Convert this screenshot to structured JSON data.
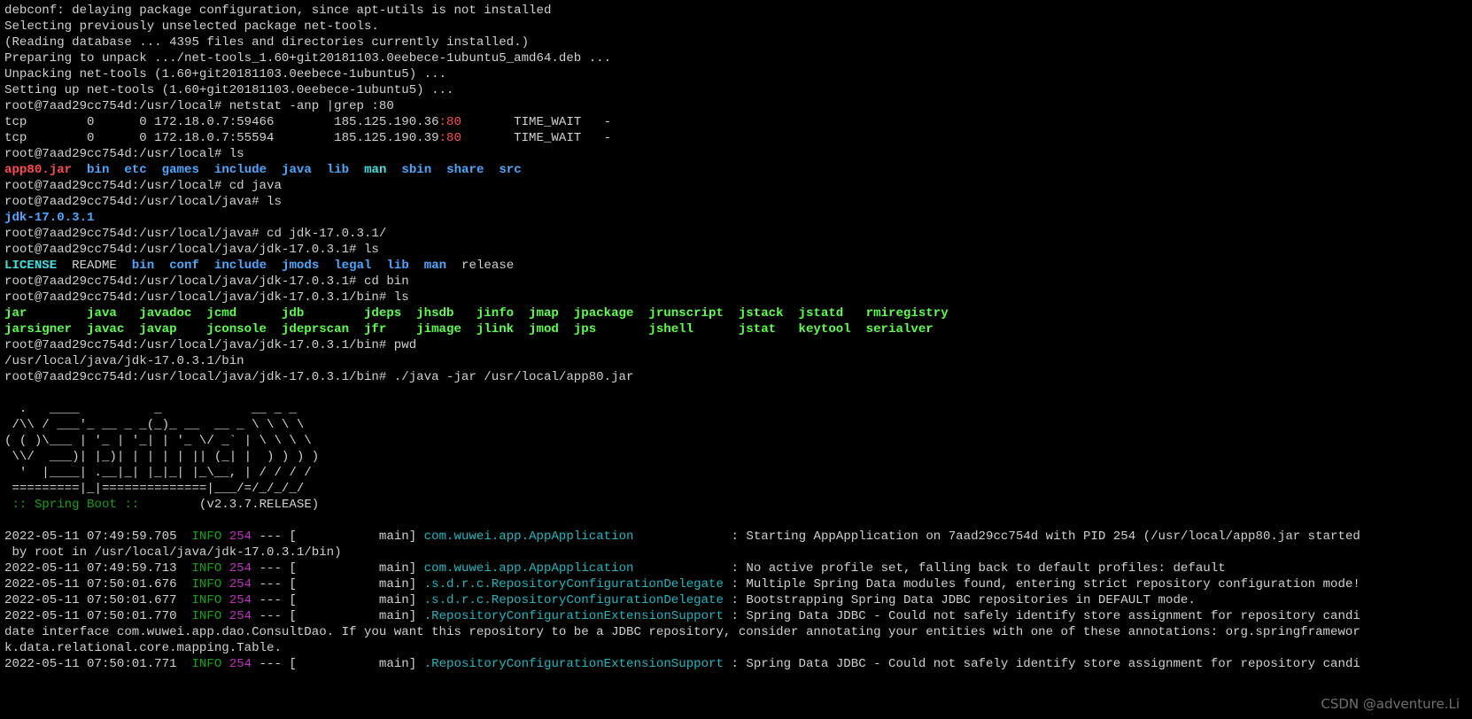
{
  "terminal": {
    "lines": [
      [
        [
          "debconf: delaying package configuration, since apt-utils is not installed",
          "n"
        ]
      ],
      [
        [
          "Selecting previously unselected package net-tools.",
          "n"
        ]
      ],
      [
        [
          "(Reading database ... 4395 files and directories currently installed.)",
          "n"
        ]
      ],
      [
        [
          "Preparing to unpack .../net-tools_1.60+git20181103.0eebece-1ubuntu5_amd64.deb ...",
          "n"
        ]
      ],
      [
        [
          "Unpacking net-tools (1.60+git20181103.0eebece-1ubuntu5) ...",
          "n"
        ]
      ],
      [
        [
          "Setting up net-tools (1.60+git20181103.0eebece-1ubuntu5) ...",
          "n"
        ]
      ],
      [
        [
          "root@7aad29cc754d:/usr/local# netstat -anp |grep :80",
          "n"
        ]
      ],
      [
        [
          "tcp        0      0 172.18.0.7:59466        185.125.190.36",
          "n"
        ],
        [
          ":80",
          "rd"
        ],
        [
          "       TIME_WAIT   -",
          "n"
        ]
      ],
      [
        [
          "tcp        0      0 172.18.0.7:55594        185.125.190.39",
          "n"
        ],
        [
          ":80",
          "rd"
        ],
        [
          "       TIME_WAIT   -",
          "n"
        ]
      ],
      [
        [
          "root@7aad29cc754d:/usr/local# ls",
          "n"
        ]
      ],
      [
        [
          "app80.jar",
          "r"
        ],
        [
          "  ",
          "n"
        ],
        [
          "bin",
          "b"
        ],
        [
          "  ",
          "n"
        ],
        [
          "etc",
          "b"
        ],
        [
          "  ",
          "n"
        ],
        [
          "games",
          "b"
        ],
        [
          "  ",
          "n"
        ],
        [
          "include",
          "b"
        ],
        [
          "  ",
          "n"
        ],
        [
          "java",
          "b"
        ],
        [
          "  ",
          "n"
        ],
        [
          "lib",
          "b"
        ],
        [
          "  ",
          "n"
        ],
        [
          "man",
          "c"
        ],
        [
          "  ",
          "n"
        ],
        [
          "sbin",
          "b"
        ],
        [
          "  ",
          "n"
        ],
        [
          "share",
          "b"
        ],
        [
          "  ",
          "n"
        ],
        [
          "src",
          "b"
        ]
      ],
      [
        [
          "root@7aad29cc754d:/usr/local# cd java",
          "n"
        ]
      ],
      [
        [
          "root@7aad29cc754d:/usr/local/java# ls",
          "n"
        ]
      ],
      [
        [
          "jdk-17.0.3.1",
          "b"
        ]
      ],
      [
        [
          "root@7aad29cc754d:/usr/local/java# cd jdk-17.0.3.1/",
          "n"
        ]
      ],
      [
        [
          "root@7aad29cc754d:/usr/local/java/jdk-17.0.3.1# ls",
          "n"
        ]
      ],
      [
        [
          "LICENSE",
          "c"
        ],
        [
          "  README  ",
          "n"
        ],
        [
          "bin",
          "b"
        ],
        [
          "  ",
          "n"
        ],
        [
          "conf",
          "b"
        ],
        [
          "  ",
          "n"
        ],
        [
          "include",
          "b"
        ],
        [
          "  ",
          "n"
        ],
        [
          "jmods",
          "b"
        ],
        [
          "  ",
          "n"
        ],
        [
          "legal",
          "b"
        ],
        [
          "  ",
          "n"
        ],
        [
          "lib",
          "b"
        ],
        [
          "  ",
          "n"
        ],
        [
          "man",
          "b"
        ],
        [
          "  release",
          "n"
        ]
      ],
      [
        [
          "root@7aad29cc754d:/usr/local/java/jdk-17.0.3.1# cd bin",
          "n"
        ]
      ],
      [
        [
          "root@7aad29cc754d:/usr/local/java/jdk-17.0.3.1/bin# ls",
          "n"
        ]
      ],
      [
        [
          "jar        java   javadoc  jcmd      jdb        jdeps  jhsdb   jinfo  jmap  jpackage  jrunscript  jstack  jstatd   rmiregistry",
          "g"
        ]
      ],
      [
        [
          "jarsigner  javac  javap    jconsole  jdeprscan  jfr    jimage  jlink  jmod  jps       jshell      jstat   keytool  serialver",
          "g"
        ]
      ],
      [
        [
          "root@7aad29cc754d:/usr/local/java/jdk-17.0.3.1/bin# pwd",
          "n"
        ]
      ],
      [
        [
          "/usr/local/java/jdk-17.0.3.1/bin",
          "n"
        ]
      ],
      [
        [
          "root@7aad29cc754d:/usr/local/java/jdk-17.0.3.1/bin# ./java -jar /usr/local/app80.jar",
          "n"
        ]
      ],
      [],
      [
        [
          "  .   ____          _            __ _ _",
          "n"
        ]
      ],
      [
        [
          " /\\\\ / ___'_ __ _ _(_)_ __  __ _ \\ \\ \\ \\",
          "n"
        ]
      ],
      [
        [
          "( ( )\\___ | '_ | '_| | '_ \\/ _` | \\ \\ \\ \\",
          "n"
        ]
      ],
      [
        [
          " \\\\/  ___)| |_)| | | | | || (_| |  ) ) ) )",
          "n"
        ]
      ],
      [
        [
          "  '  |____| .__|_| |_|_| |_\\__, | / / / /",
          "n"
        ]
      ],
      [
        [
          " =========|_|==============|___/=/_/_/_/",
          "n"
        ]
      ],
      [
        [
          " :: Spring Boot ::",
          "dg"
        ],
        [
          "        (v2.3.7.RELEASE)",
          "n"
        ]
      ],
      [],
      [
        [
          "2022-05-11 07:49:59.705  ",
          "n"
        ],
        [
          "INFO",
          "dg"
        ],
        [
          " ",
          "n"
        ],
        [
          "254",
          "m"
        ],
        [
          " --- [           main] ",
          "n"
        ],
        [
          "com.wuwei.app.AppApplication",
          "cy"
        ],
        [
          "             : Starting AppApplication on 7aad29cc754d with PID 254 (/usr/local/app80.jar started",
          "n"
        ]
      ],
      [
        [
          " by root in /usr/local/java/jdk-17.0.3.1/bin)",
          "n"
        ]
      ],
      [
        [
          "2022-05-11 07:49:59.713  ",
          "n"
        ],
        [
          "INFO",
          "dg"
        ],
        [
          " ",
          "n"
        ],
        [
          "254",
          "m"
        ],
        [
          " --- [           main] ",
          "n"
        ],
        [
          "com.wuwei.app.AppApplication",
          "cy"
        ],
        [
          "             : No active profile set, falling back to default profiles: default",
          "n"
        ]
      ],
      [
        [
          "2022-05-11 07:50:01.676  ",
          "n"
        ],
        [
          "INFO",
          "dg"
        ],
        [
          " ",
          "n"
        ],
        [
          "254",
          "m"
        ],
        [
          " --- [           main] ",
          "n"
        ],
        [
          ".s.d.r.c.RepositoryConfigurationDelegate",
          "cy"
        ],
        [
          " : Multiple Spring Data modules found, entering strict repository configuration mode!",
          "n"
        ]
      ],
      [
        [
          "2022-05-11 07:50:01.677  ",
          "n"
        ],
        [
          "INFO",
          "dg"
        ],
        [
          " ",
          "n"
        ],
        [
          "254",
          "m"
        ],
        [
          " --- [           main] ",
          "n"
        ],
        [
          ".s.d.r.c.RepositoryConfigurationDelegate",
          "cy"
        ],
        [
          " : Bootstrapping Spring Data JDBC repositories in DEFAULT mode.",
          "n"
        ]
      ],
      [
        [
          "2022-05-11 07:50:01.770  ",
          "n"
        ],
        [
          "INFO",
          "dg"
        ],
        [
          " ",
          "n"
        ],
        [
          "254",
          "m"
        ],
        [
          " --- [           main] ",
          "n"
        ],
        [
          ".RepositoryConfigurationExtensionSupport",
          "cy"
        ],
        [
          " : Spring Data JDBC - Could not safely identify store assignment for repository candi",
          "n"
        ]
      ],
      [
        [
          "date interface com.wuwei.app.dao.ConsultDao. If you want this repository to be a JDBC repository, consider annotating your entities with one of these annotations: org.springframewor",
          "n"
        ]
      ],
      [
        [
          "k.data.relational.core.mapping.Table.",
          "n"
        ]
      ],
      [
        [
          "2022-05-11 07:50:01.771  ",
          "n"
        ],
        [
          "INFO",
          "dg"
        ],
        [
          " ",
          "n"
        ],
        [
          "254",
          "m"
        ],
        [
          " --- [           main] ",
          "n"
        ],
        [
          ".RepositoryConfigurationExtensionSupport",
          "cy"
        ],
        [
          " : Spring Data JDBC - Could not safely identify store assignment for repository candi",
          "n"
        ]
      ]
    ]
  },
  "watermark": "CSDN @adventure.Li",
  "colors": {
    "background": "#000000",
    "text": "#d0d0d0",
    "executable": "#5cff4a",
    "directory": "#4aa8ff",
    "symlink": "#3fe0e0",
    "archive": "#ff4b4b",
    "log_level": "#14a014",
    "pid": "#c030c0",
    "logger": "#1cb8c0"
  }
}
